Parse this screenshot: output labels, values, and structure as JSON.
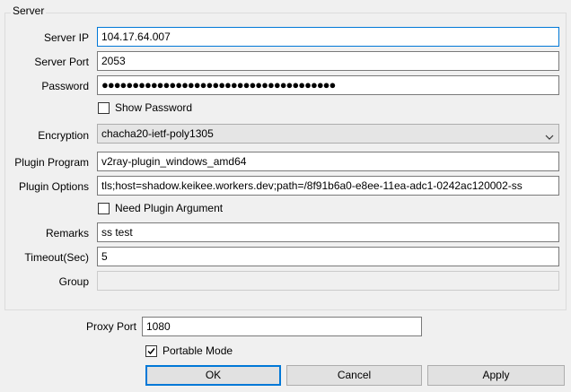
{
  "server_group": {
    "title": "Server",
    "server_ip": {
      "label": "Server IP",
      "value": "104.17.64.007"
    },
    "server_port": {
      "label": "Server Port",
      "value": "2053"
    },
    "password": {
      "label": "Password",
      "value": "●●●●●●●●●●●●●●●●●●●●●●●●●●●●●●●●●●●●●●"
    },
    "show_password": {
      "label": "Show Password",
      "checked": false
    },
    "encryption": {
      "label": "Encryption",
      "value": "chacha20-ietf-poly1305",
      "icon": "chevron-down-icon"
    },
    "plugin_program": {
      "label": "Plugin Program",
      "value": "v2ray-plugin_windows_amd64"
    },
    "plugin_options": {
      "label": "Plugin Options",
      "value": "tls;host=shadow.keikee.workers.dev;path=/8f91b6a0-e8ee-11ea-adc1-0242ac120002-ss"
    },
    "need_plugin_argument": {
      "label": "Need Plugin Argument",
      "checked": false
    },
    "remarks": {
      "label": "Remarks",
      "value": "ss test"
    },
    "timeout": {
      "label": "Timeout(Sec)",
      "value": "5"
    },
    "group": {
      "label": "Group",
      "value": ""
    }
  },
  "proxy_port": {
    "label": "Proxy Port",
    "value": "1080"
  },
  "portable_mode": {
    "label": "Portable Mode",
    "checked": true
  },
  "buttons": {
    "ok": "OK",
    "cancel": "Cancel",
    "apply": "Apply"
  },
  "colors": {
    "focus_border": "#0078d7",
    "background": "#f0f0f0"
  }
}
